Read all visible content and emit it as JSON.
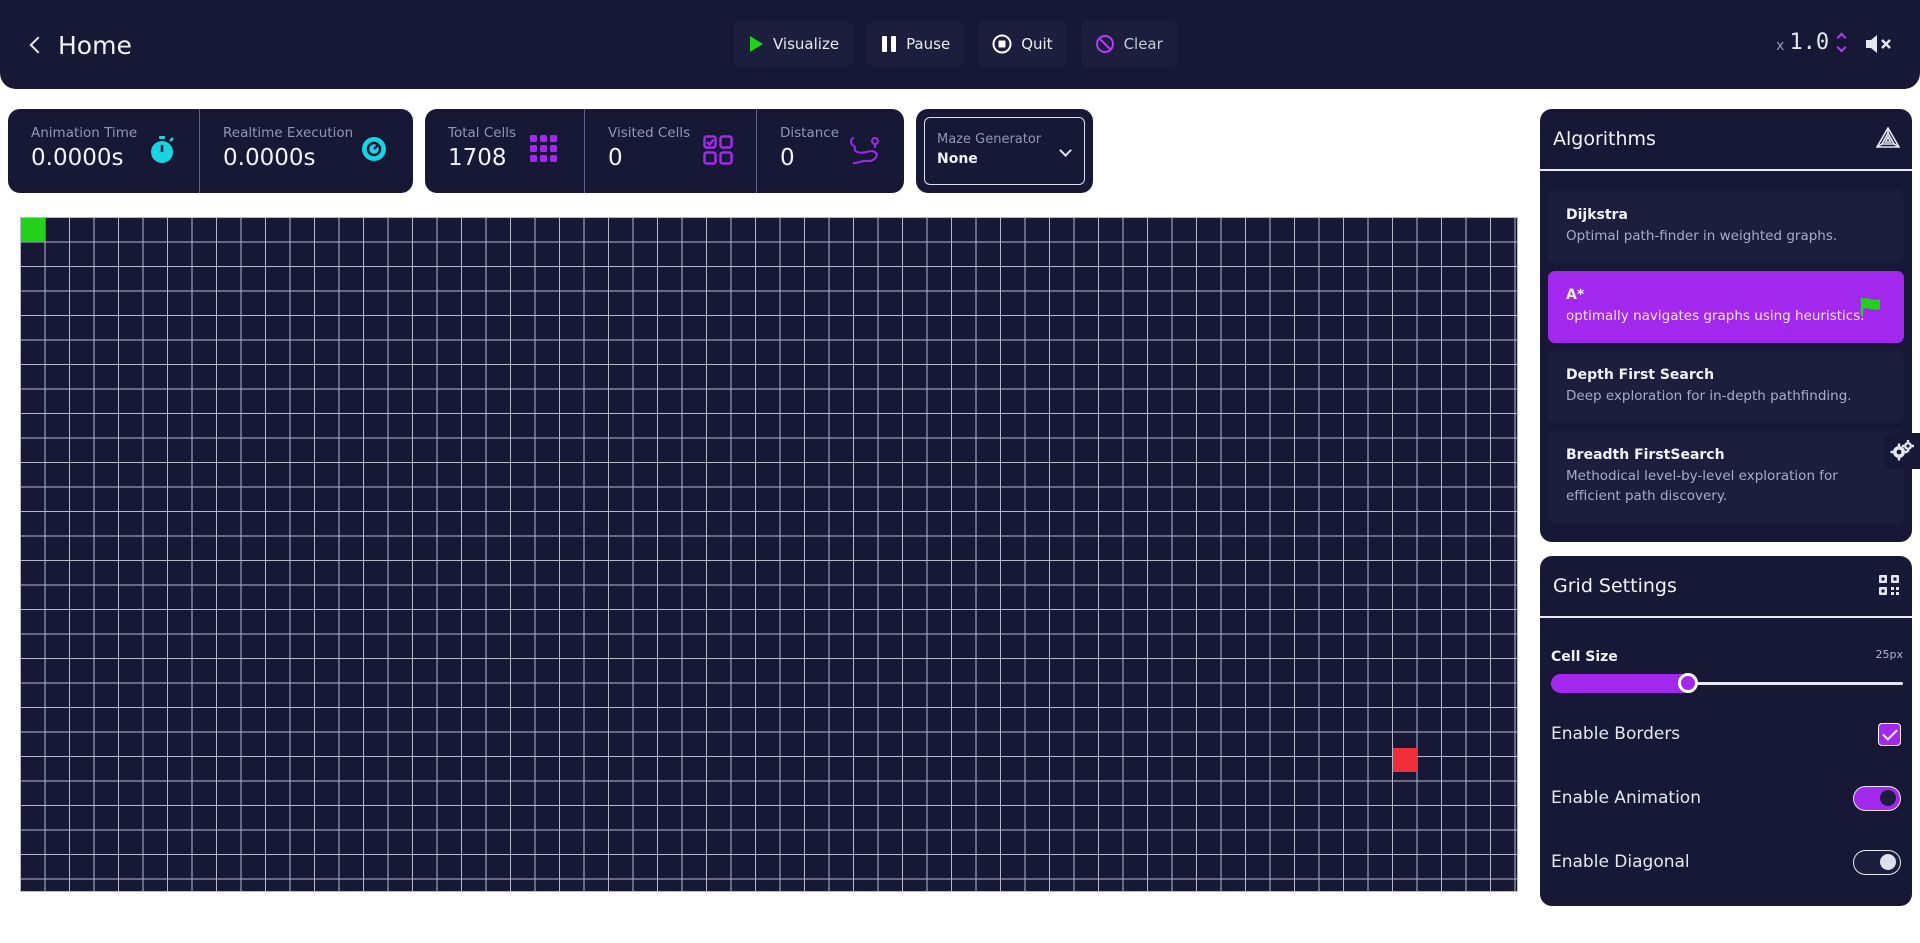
{
  "header": {
    "back_label": "Home",
    "controls": [
      {
        "label": "Visualize",
        "icon": "play-icon"
      },
      {
        "label": "Pause",
        "icon": "pause-icon"
      },
      {
        "label": "Quit",
        "icon": "stop-icon"
      },
      {
        "label": "Clear",
        "icon": "clear-icon"
      }
    ],
    "speed_prefix": "x",
    "speed_value": "1.0",
    "mute_icon": "volume-mute-icon"
  },
  "stats": {
    "animation_time": {
      "label": "Animation Time",
      "value": "0.0000s"
    },
    "realtime_execution": {
      "label": "Realtime Execution",
      "value": "0.0000s"
    },
    "total_cells": {
      "label": "Total Cells",
      "value": "1708"
    },
    "visited_cells": {
      "label": "Visited Cells",
      "value": "0"
    },
    "distance": {
      "label": "Distance",
      "value": "0"
    }
  },
  "maze_generator": {
    "label": "Maze Generator",
    "value": "None"
  },
  "algorithms": {
    "title": "Algorithms",
    "items": [
      {
        "name": "Dijkstra",
        "desc": "Optimal path-finder in weighted graphs.",
        "selected": false
      },
      {
        "name": "A*",
        "desc": "optimally navigates graphs using heuristics.",
        "selected": true
      },
      {
        "name": "Depth First Search",
        "desc": "Deep exploration for in-depth pathfinding.",
        "selected": false
      },
      {
        "name": "Breadth FirstSearch",
        "desc": "Methodical level-by-level exploration for efficient path discovery.",
        "selected": false
      }
    ]
  },
  "grid_settings": {
    "title": "Grid Settings",
    "cell_size_label": "Cell Size",
    "cell_size_value": "25px",
    "cell_size_fraction": 0.39,
    "enable_borders": {
      "label": "Enable Borders",
      "checked": true
    },
    "enable_animation": {
      "label": "Enable Animation",
      "on": true
    },
    "enable_diagonal": {
      "label": "Enable Diagonal",
      "on": false
    }
  },
  "colors": {
    "background": "#171835",
    "accent": "#a228ee",
    "start_node": "#22d11a",
    "end_node": "#ef2e3a",
    "stat_icon_cyan": "#19d3e0"
  }
}
